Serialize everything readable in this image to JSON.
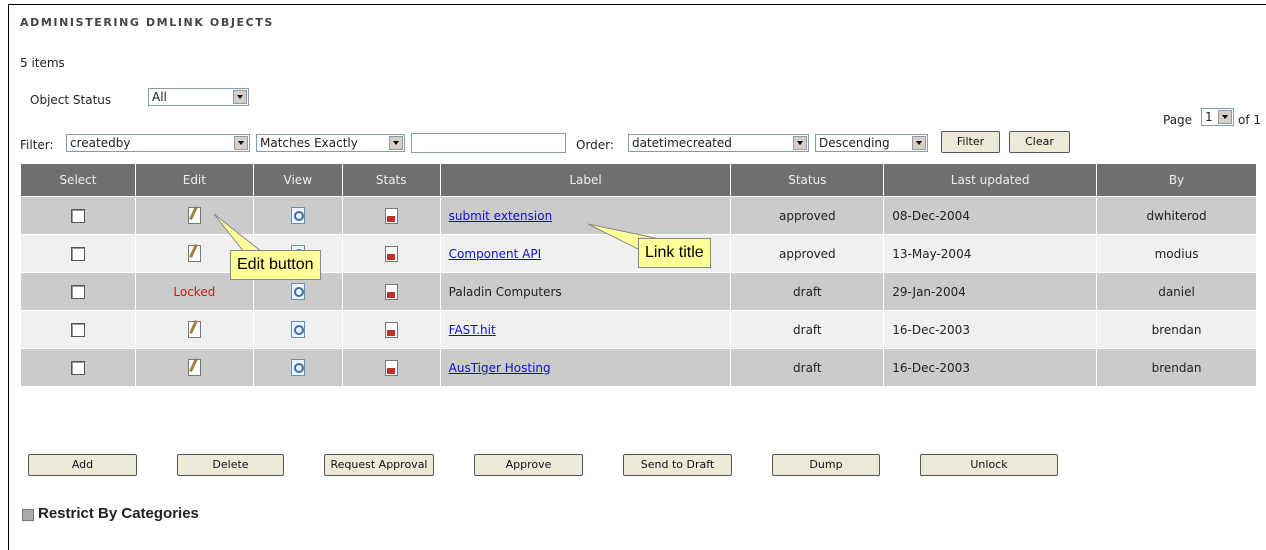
{
  "page": {
    "title": "ADMINISTERING DMLINK OBJECTS",
    "item_count": "5 items"
  },
  "object_status": {
    "label": "Object Status",
    "value": "All"
  },
  "pagination": {
    "page_label": "Page",
    "page_value": "1",
    "of_label": "of 1"
  },
  "filter": {
    "label": "Filter:",
    "field": "createdby",
    "match": "Matches Exactly",
    "text_value": "",
    "order_label": "Order:",
    "order_field": "datetimecreated",
    "order_dir": "Descending",
    "filter_button": "Filter",
    "clear_button": "Clear"
  },
  "table": {
    "headers": [
      "Select",
      "Edit",
      "View",
      "Stats",
      "Label",
      "Status",
      "Last updated",
      "By"
    ],
    "rows": [
      {
        "label": "submit extension",
        "linked": true,
        "status": "approved",
        "updated": "08-Dec-2004",
        "by": "dwhiterod",
        "locked": false
      },
      {
        "label": "Component API",
        "linked": true,
        "status": "approved",
        "updated": "13-May-2004",
        "by": "modius",
        "locked": false
      },
      {
        "label": "Paladin Computers",
        "linked": false,
        "status": "draft",
        "updated": "29-Jan-2004",
        "by": "daniel",
        "locked": true,
        "locked_text": "Locked"
      },
      {
        "label": "FAST.hit",
        "linked": true,
        "status": "draft",
        "updated": "16-Dec-2003",
        "by": "brendan",
        "locked": false
      },
      {
        "label": "AusTiger Hosting",
        "linked": true,
        "status": "draft",
        "updated": "16-Dec-2003",
        "by": "brendan",
        "locked": false
      }
    ]
  },
  "callouts": {
    "edit": "Edit button",
    "link": "Link title"
  },
  "actions": [
    "Add",
    "Delete",
    "Request Approval",
    "Approve",
    "Send to Draft",
    "Dump",
    "Unlock"
  ],
  "restrict": {
    "label": "Restrict By Categories"
  },
  "colors": {
    "header_bg": "#6f6f6f",
    "row_dark": "#cbcbcb",
    "row_light": "#f0f0f0",
    "link": "#1010cc",
    "locked": "#e01010",
    "callout": "#ffff99"
  }
}
